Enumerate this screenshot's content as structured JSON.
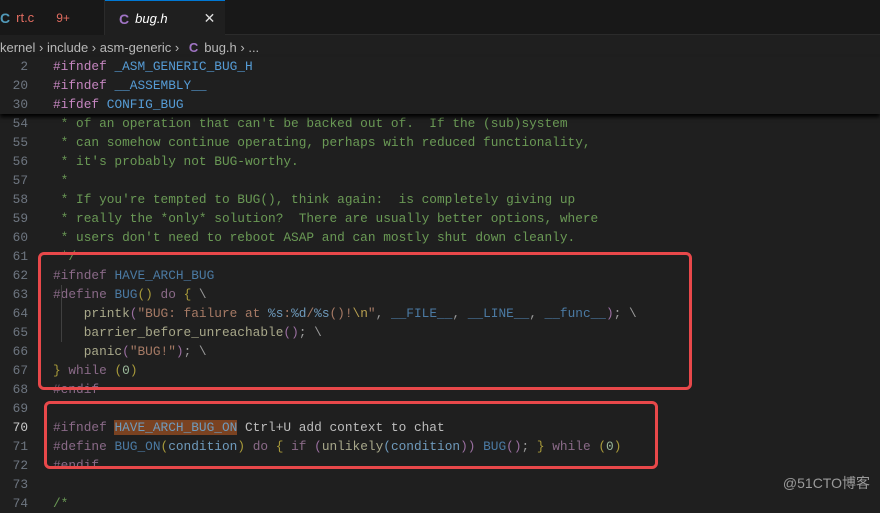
{
  "tabs": [
    {
      "icon": "C",
      "label": "rt.c",
      "badge": "9+"
    },
    {
      "icon": "C",
      "label": "bug.h",
      "close": "✕"
    }
  ],
  "breadcrumb": [
    "kernel",
    " › ",
    "include",
    " › ",
    "asm-generic",
    " › ",
    "C",
    "bug.h",
    " › ..."
  ],
  "sticky": [
    {
      "n": "2",
      "tokens": [
        {
          "t": "#ifndef ",
          "c": "kw"
        },
        {
          "t": "_ASM_GENERIC_BUG_H",
          "c": "mac"
        }
      ]
    },
    {
      "n": "20",
      "tokens": [
        {
          "t": "#ifndef ",
          "c": "kw"
        },
        {
          "t": "__ASSEMBLY__",
          "c": "mac"
        }
      ]
    },
    {
      "n": "30",
      "tokens": [
        {
          "t": "#ifdef ",
          "c": "kw"
        },
        {
          "t": "CONFIG_BUG",
          "c": "mac"
        }
      ]
    }
  ],
  "lines": [
    {
      "n": "54",
      "tokens": [
        {
          "t": " * of an operation that can't be backed out of.  If the (sub)system",
          "c": "cm"
        }
      ]
    },
    {
      "n": "55",
      "tokens": [
        {
          "t": " * can somehow continue operating, perhaps with reduced functionality,",
          "c": "cm"
        }
      ]
    },
    {
      "n": "56",
      "tokens": [
        {
          "t": " * it's probably not BUG-worthy.",
          "c": "cm"
        }
      ]
    },
    {
      "n": "57",
      "tokens": [
        {
          "t": " *",
          "c": "cm"
        }
      ]
    },
    {
      "n": "58",
      "tokens": [
        {
          "t": " * If you're tempted to BUG(), think again:  is completely giving up",
          "c": "cm"
        }
      ]
    },
    {
      "n": "59",
      "tokens": [
        {
          "t": " * really the *only* solution?  There are usually better options, where",
          "c": "cm"
        }
      ]
    },
    {
      "n": "60",
      "tokens": [
        {
          "t": " * users don't need to reboot ASAP and can mostly shut down cleanly.",
          "c": "cm"
        }
      ]
    },
    {
      "n": "61",
      "tokens": [
        {
          "t": " */",
          "c": "cm"
        }
      ]
    },
    {
      "n": "62",
      "tokens": [
        {
          "t": "#ifndef ",
          "c": "d-kw"
        },
        {
          "t": "HAVE_ARCH_BUG",
          "c": "d-mac"
        }
      ]
    },
    {
      "n": "63",
      "tokens": [
        {
          "t": "#define ",
          "c": "d-kw"
        },
        {
          "t": "BUG",
          "c": "d-mac"
        },
        {
          "t": "()",
          "c": "d-br"
        },
        {
          "t": " do ",
          "c": "d-kw"
        },
        {
          "t": "{",
          "c": "d-br"
        },
        {
          "t": " \\",
          "c": "d-pl"
        }
      ]
    },
    {
      "n": "64",
      "tokens": [
        {
          "t": "    printk",
          "c": "d-fn"
        },
        {
          "t": "(",
          "c": "d-pp"
        },
        {
          "t": "\"BUG: failure at ",
          "c": "d-str"
        },
        {
          "t": "%s",
          "c": "d-var"
        },
        {
          "t": ":",
          "c": "d-str"
        },
        {
          "t": "%d",
          "c": "d-var"
        },
        {
          "t": "/",
          "c": "d-str"
        },
        {
          "t": "%s",
          "c": "d-var"
        },
        {
          "t": "()!",
          "c": "d-str"
        },
        {
          "t": "\\n",
          "c": "d-esc"
        },
        {
          "t": "\"",
          "c": "d-str"
        },
        {
          "t": ", ",
          "c": "d-pl"
        },
        {
          "t": "__FILE__",
          "c": "d-mac"
        },
        {
          "t": ", ",
          "c": "d-pl"
        },
        {
          "t": "__LINE__",
          "c": "d-mac"
        },
        {
          "t": ", ",
          "c": "d-pl"
        },
        {
          "t": "__func__",
          "c": "d-mac"
        },
        {
          "t": ")",
          "c": "d-pp"
        },
        {
          "t": "; \\",
          "c": "d-pl"
        }
      ]
    },
    {
      "n": "65",
      "tokens": [
        {
          "t": "    barrier_before_unreachable",
          "c": "d-fn"
        },
        {
          "t": "()",
          "c": "d-pp"
        },
        {
          "t": "; \\",
          "c": "d-pl"
        }
      ]
    },
    {
      "n": "66",
      "tokens": [
        {
          "t": "    panic",
          "c": "d-fn"
        },
        {
          "t": "(",
          "c": "d-pp"
        },
        {
          "t": "\"BUG!\"",
          "c": "d-str"
        },
        {
          "t": ")",
          "c": "d-pp"
        },
        {
          "t": "; \\",
          "c": "d-pl"
        }
      ]
    },
    {
      "n": "67",
      "tokens": [
        {
          "t": "}",
          "c": "d-br"
        },
        {
          "t": " while ",
          "c": "d-kw"
        },
        {
          "t": "(",
          "c": "d-br"
        },
        {
          "t": "0",
          "c": "d-num"
        },
        {
          "t": ")",
          "c": "d-br"
        }
      ]
    },
    {
      "n": "68",
      "tokens": [
        {
          "t": "#endif",
          "c": "d-kw"
        }
      ]
    },
    {
      "n": "69",
      "tokens": []
    },
    {
      "n": "70",
      "cur": true,
      "tokens": [
        {
          "t": "#ifndef ",
          "c": "d-kw"
        },
        {
          "t": "HAVE_ARCH_BUG_ON",
          "c": "hl"
        },
        {
          "t": " Ctrl+U add context to chat",
          "c": "ghost"
        }
      ]
    },
    {
      "n": "71",
      "tokens": [
        {
          "t": "#define ",
          "c": "d-kw"
        },
        {
          "t": "BUG_ON",
          "c": "d-mac"
        },
        {
          "t": "(",
          "c": "d-br"
        },
        {
          "t": "condition",
          "c": "d-var"
        },
        {
          "t": ")",
          "c": "d-br"
        },
        {
          "t": " do ",
          "c": "d-kw"
        },
        {
          "t": "{",
          "c": "d-br"
        },
        {
          "t": " if ",
          "c": "d-kw"
        },
        {
          "t": "(",
          "c": "d-pp"
        },
        {
          "t": "unlikely",
          "c": "d-fn"
        },
        {
          "t": "(",
          "c": "d-var"
        },
        {
          "t": "condition",
          "c": "d-var"
        },
        {
          "t": "))",
          "c": "d-pp"
        },
        {
          "t": " BUG",
          "c": "d-mac"
        },
        {
          "t": "()",
          "c": "d-pp"
        },
        {
          "t": "; ",
          "c": "d-pl"
        },
        {
          "t": "}",
          "c": "d-br"
        },
        {
          "t": " while ",
          "c": "d-kw"
        },
        {
          "t": "(",
          "c": "d-br"
        },
        {
          "t": "0",
          "c": "d-num"
        },
        {
          "t": ")",
          "c": "d-br"
        }
      ]
    },
    {
      "n": "72",
      "tokens": [
        {
          "t": "#endif",
          "c": "d-kw"
        }
      ]
    },
    {
      "n": "73",
      "tokens": []
    },
    {
      "n": "74",
      "tokens": [
        {
          "t": "/*",
          "c": "cm"
        }
      ]
    }
  ],
  "watermark": "@51CTO博客",
  "colors": {
    "highlight_box": "#e8484a",
    "accent": "#0078d4"
  }
}
